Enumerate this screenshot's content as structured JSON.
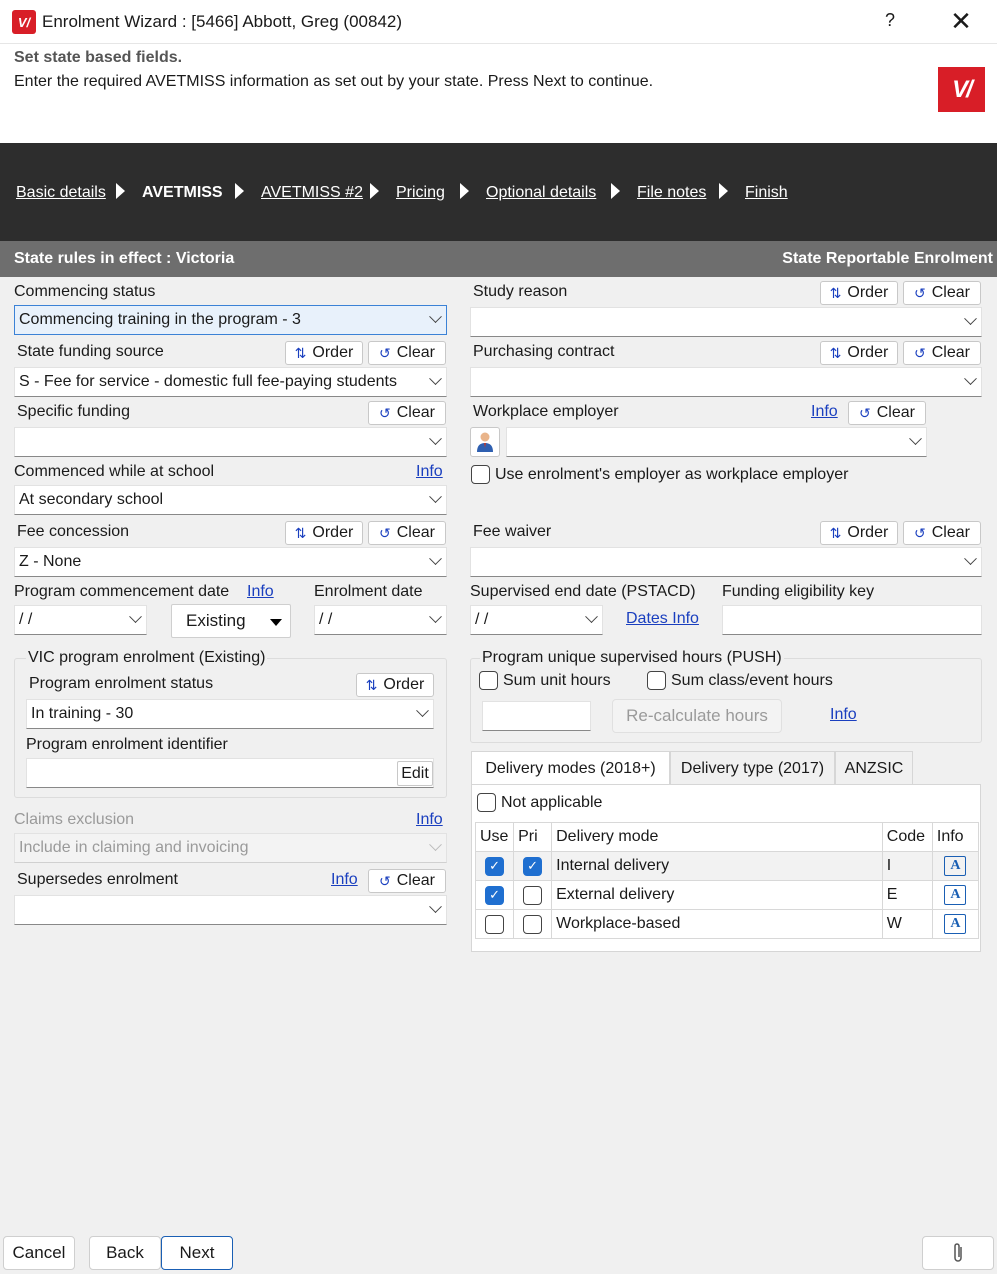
{
  "window": {
    "title": "Enrolment Wizard : [5466] Abbott, Greg (00842)",
    "help": "?",
    "close": "✕",
    "logo_text": "V/"
  },
  "header": {
    "title": "Set state based fields.",
    "subtitle": "Enter the required AVETMISS information as set out by your state.  Press Next to continue."
  },
  "steps": [
    "Basic details",
    "AVETMISS",
    "AVETMISS #2",
    "Pricing",
    "Optional details",
    "File notes",
    "Finish"
  ],
  "state_bar": {
    "left": "State rules in effect : Victoria",
    "right": "State Reportable Enrolment"
  },
  "buttons": {
    "order": "Order",
    "clear": "Clear",
    "info": "Info",
    "edit": "Edit",
    "existing": "Existing"
  },
  "left": {
    "commencing_status": {
      "label": "Commencing status",
      "value": "Commencing training in the program - 3"
    },
    "state_funding_source": {
      "label": "State funding source",
      "value": "S - Fee for service - domestic full fee-paying students"
    },
    "specific_funding": {
      "label": "Specific funding",
      "value": ""
    },
    "commenced_at_school": {
      "label": "Commenced while at school",
      "value": "At secondary school"
    },
    "fee_concession": {
      "label": "Fee concession",
      "value": "Z - None"
    },
    "program_commencement_date": {
      "label": "Program commencement date",
      "value": " /  /"
    },
    "enrolment_date": {
      "label": "Enrolment date",
      "value": " /  /"
    },
    "vic_group": {
      "title": "VIC program enrolment (Existing)",
      "status_label": "Program enrolment status",
      "status_value": "In training - 30",
      "identifier_label": "Program enrolment identifier",
      "identifier_value": ""
    },
    "claims_exclusion": {
      "label": "Claims exclusion",
      "value": "Include in claiming and invoicing"
    },
    "supersedes_enrolment": {
      "label": "Supersedes enrolment",
      "value": ""
    }
  },
  "right": {
    "study_reason": {
      "label": "Study reason",
      "value": ""
    },
    "purchasing_contract": {
      "label": "Purchasing contract",
      "value": ""
    },
    "workplace_employer": {
      "label": "Workplace employer",
      "value": ""
    },
    "use_employer_checkbox": "Use enrolment's employer as workplace employer",
    "fee_waiver": {
      "label": "Fee waiver",
      "value": ""
    },
    "supervised_end_date": {
      "label": "Supervised end date (PSTACD)",
      "value": " /  /"
    },
    "dates_info": "Dates Info",
    "funding_eligibility_key": {
      "label": "Funding eligibility key",
      "value": ""
    },
    "push_group": {
      "title": "Program unique supervised hours (PUSH)",
      "sum_unit_hours": "Sum unit hours",
      "sum_class_hours": "Sum class/event hours",
      "hours_value": "",
      "recalc": "Re-calculate hours"
    },
    "tabs": [
      "Delivery modes (2018+)",
      "Delivery type (2017)",
      "ANZSIC"
    ],
    "not_applicable": "Not applicable",
    "delivery_table": {
      "headers": [
        "Use",
        "Pri",
        "Delivery mode",
        "Code",
        "Info"
      ],
      "rows": [
        {
          "use": true,
          "pri": true,
          "mode": "Internal delivery",
          "code": "I"
        },
        {
          "use": true,
          "pri": false,
          "mode": "External delivery",
          "code": "E"
        },
        {
          "use": false,
          "pri": false,
          "mode": "Workplace-based",
          "code": "W"
        }
      ]
    }
  },
  "footer": {
    "cancel": "Cancel",
    "back": "Back",
    "next": "Next",
    "attach_icon": "paperclip-icon"
  },
  "colors": {
    "brand": "#d81e27",
    "nav_bg": "#2d2d2d",
    "state_bar": "#6e6e6e",
    "link": "#1a3fbf",
    "check": "#1f6fd0"
  }
}
